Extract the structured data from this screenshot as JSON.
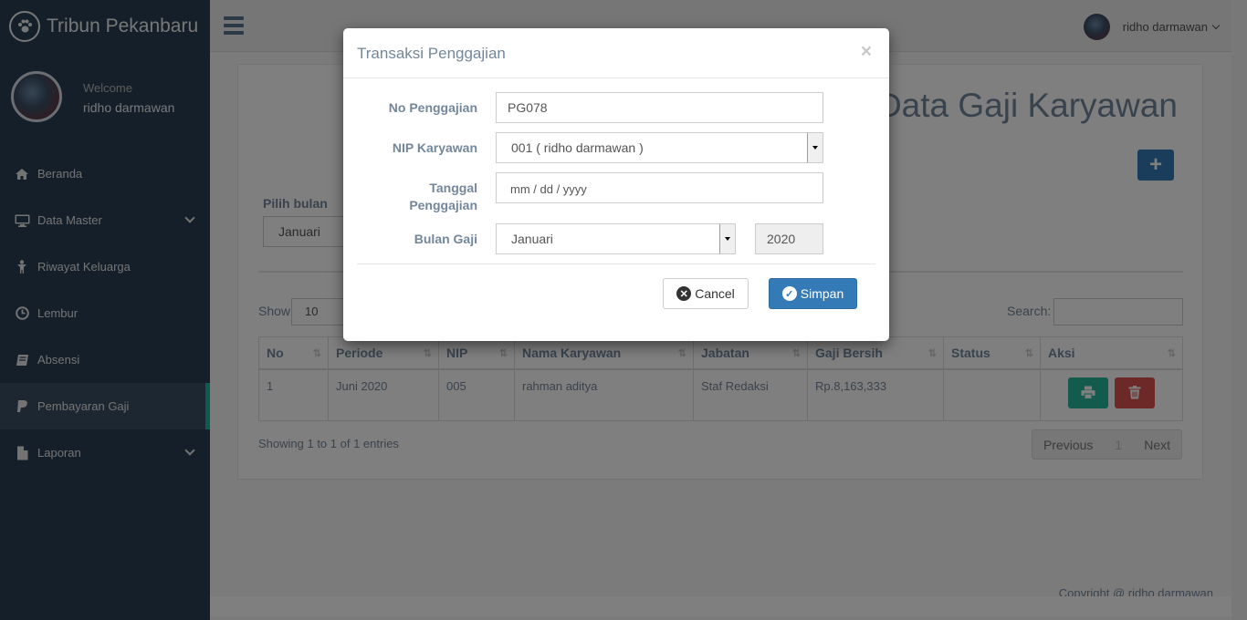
{
  "brand": {
    "title": "Tribun Pekanbaru"
  },
  "profile": {
    "welcome": "Welcome",
    "name": "ridho darmawan"
  },
  "menu": [
    {
      "label": "Beranda",
      "icon": "home-icon"
    },
    {
      "label": "Data Master",
      "icon": "monitor-icon"
    },
    {
      "label": "Riwayat Keluarga",
      "icon": "child-icon"
    },
    {
      "label": "Lembur",
      "icon": "clock-icon"
    },
    {
      "label": "Absensi",
      "icon": "book-icon"
    },
    {
      "label": "Pembayaran Gaji",
      "icon": "paypal-icon"
    },
    {
      "label": "Laporan",
      "icon": "file-icon"
    }
  ],
  "topbar": {
    "user": "ridho darmawan"
  },
  "page": {
    "title": "Data Gaji Karyawan",
    "filter_label": "Pilih bulan",
    "filter_value": "Januari",
    "show_label": "Show",
    "show_value": "10",
    "search_label": "Search:"
  },
  "table": {
    "headers": [
      "No",
      "Periode",
      "NIP",
      "Nama Karyawan",
      "Jabatan",
      "Gaji Bersih",
      "Status",
      "Aksi"
    ],
    "rows": [
      {
        "no": "1",
        "periode": "Juni 2020",
        "nip": "005",
        "nama": "rahman aditya",
        "jabatan": "Staf Redaksi",
        "gaji": "Rp.8,163,333",
        "status": ""
      }
    ]
  },
  "pagination": {
    "info": "Showing 1 to 1 of 1 entries",
    "prev": "Previous",
    "page": "1",
    "next": "Next"
  },
  "footer": {
    "text": "Copyright @ ridho darmawan"
  },
  "modal": {
    "title": "Transaksi Penggajian",
    "close": "×",
    "no_label": "No Penggajian",
    "no_value": "PG078",
    "nip_label": "NIP Karyawan",
    "nip_value": "001 ( ridho darmawan )",
    "tanggal_label_1": "Tanggal",
    "tanggal_label_2": "Penggajian",
    "tanggal_placeholder": "mm / dd / yyyy",
    "bulan_label": "Bulan Gaji",
    "bulan_value": "Januari",
    "tahun_value": "2020",
    "cancel": "Cancel",
    "save": "Simpan"
  },
  "colors": {
    "sidebar": "#2a3f54",
    "accent": "#1abb9c",
    "primary": "#337ab7",
    "success": "#26b99a",
    "danger": "#d9534f"
  }
}
